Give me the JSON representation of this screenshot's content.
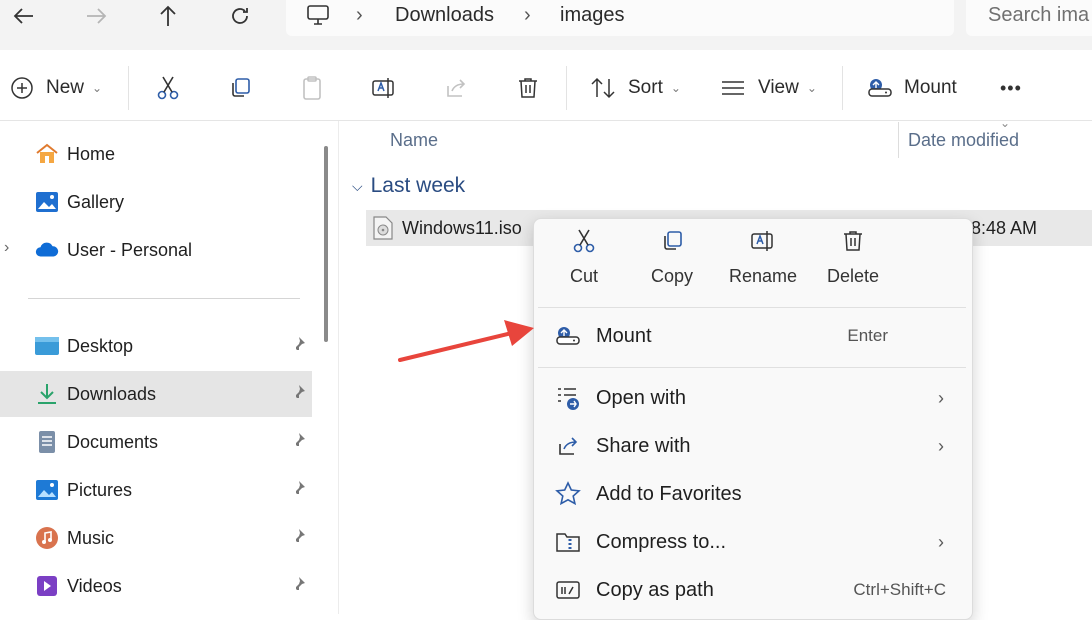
{
  "address": {
    "crumbs": [
      "Downloads",
      "images"
    ],
    "search_placeholder": "Search ima"
  },
  "toolbar": {
    "new_label": "New",
    "sort_label": "Sort",
    "view_label": "View",
    "mount_label": "Mount",
    "more_label": "•••"
  },
  "sidebar": {
    "items": [
      {
        "label": "Home"
      },
      {
        "label": "Gallery"
      },
      {
        "label": "User - Personal"
      },
      {
        "label": "Desktop"
      },
      {
        "label": "Downloads"
      },
      {
        "label": "Documents"
      },
      {
        "label": "Pictures"
      },
      {
        "label": "Music"
      },
      {
        "label": "Videos"
      }
    ]
  },
  "list": {
    "col_name": "Name",
    "col_date": "Date modified",
    "group_label": "Last week",
    "file_name": "Windows11.iso",
    "file_date": "5 8:48 AM"
  },
  "context_menu": {
    "quick_actions": [
      {
        "label": "Cut"
      },
      {
        "label": "Copy"
      },
      {
        "label": "Rename"
      },
      {
        "label": "Delete"
      }
    ],
    "items": [
      {
        "label": "Mount",
        "shortcut": "Enter"
      },
      {
        "label": "Open with"
      },
      {
        "label": "Share with"
      },
      {
        "label": "Add to Favorites"
      },
      {
        "label": "Compress to..."
      },
      {
        "label": "Copy as path",
        "shortcut": "Ctrl+Shift+C"
      }
    ]
  },
  "annotation": {
    "arrow_color": "#e8453c"
  }
}
